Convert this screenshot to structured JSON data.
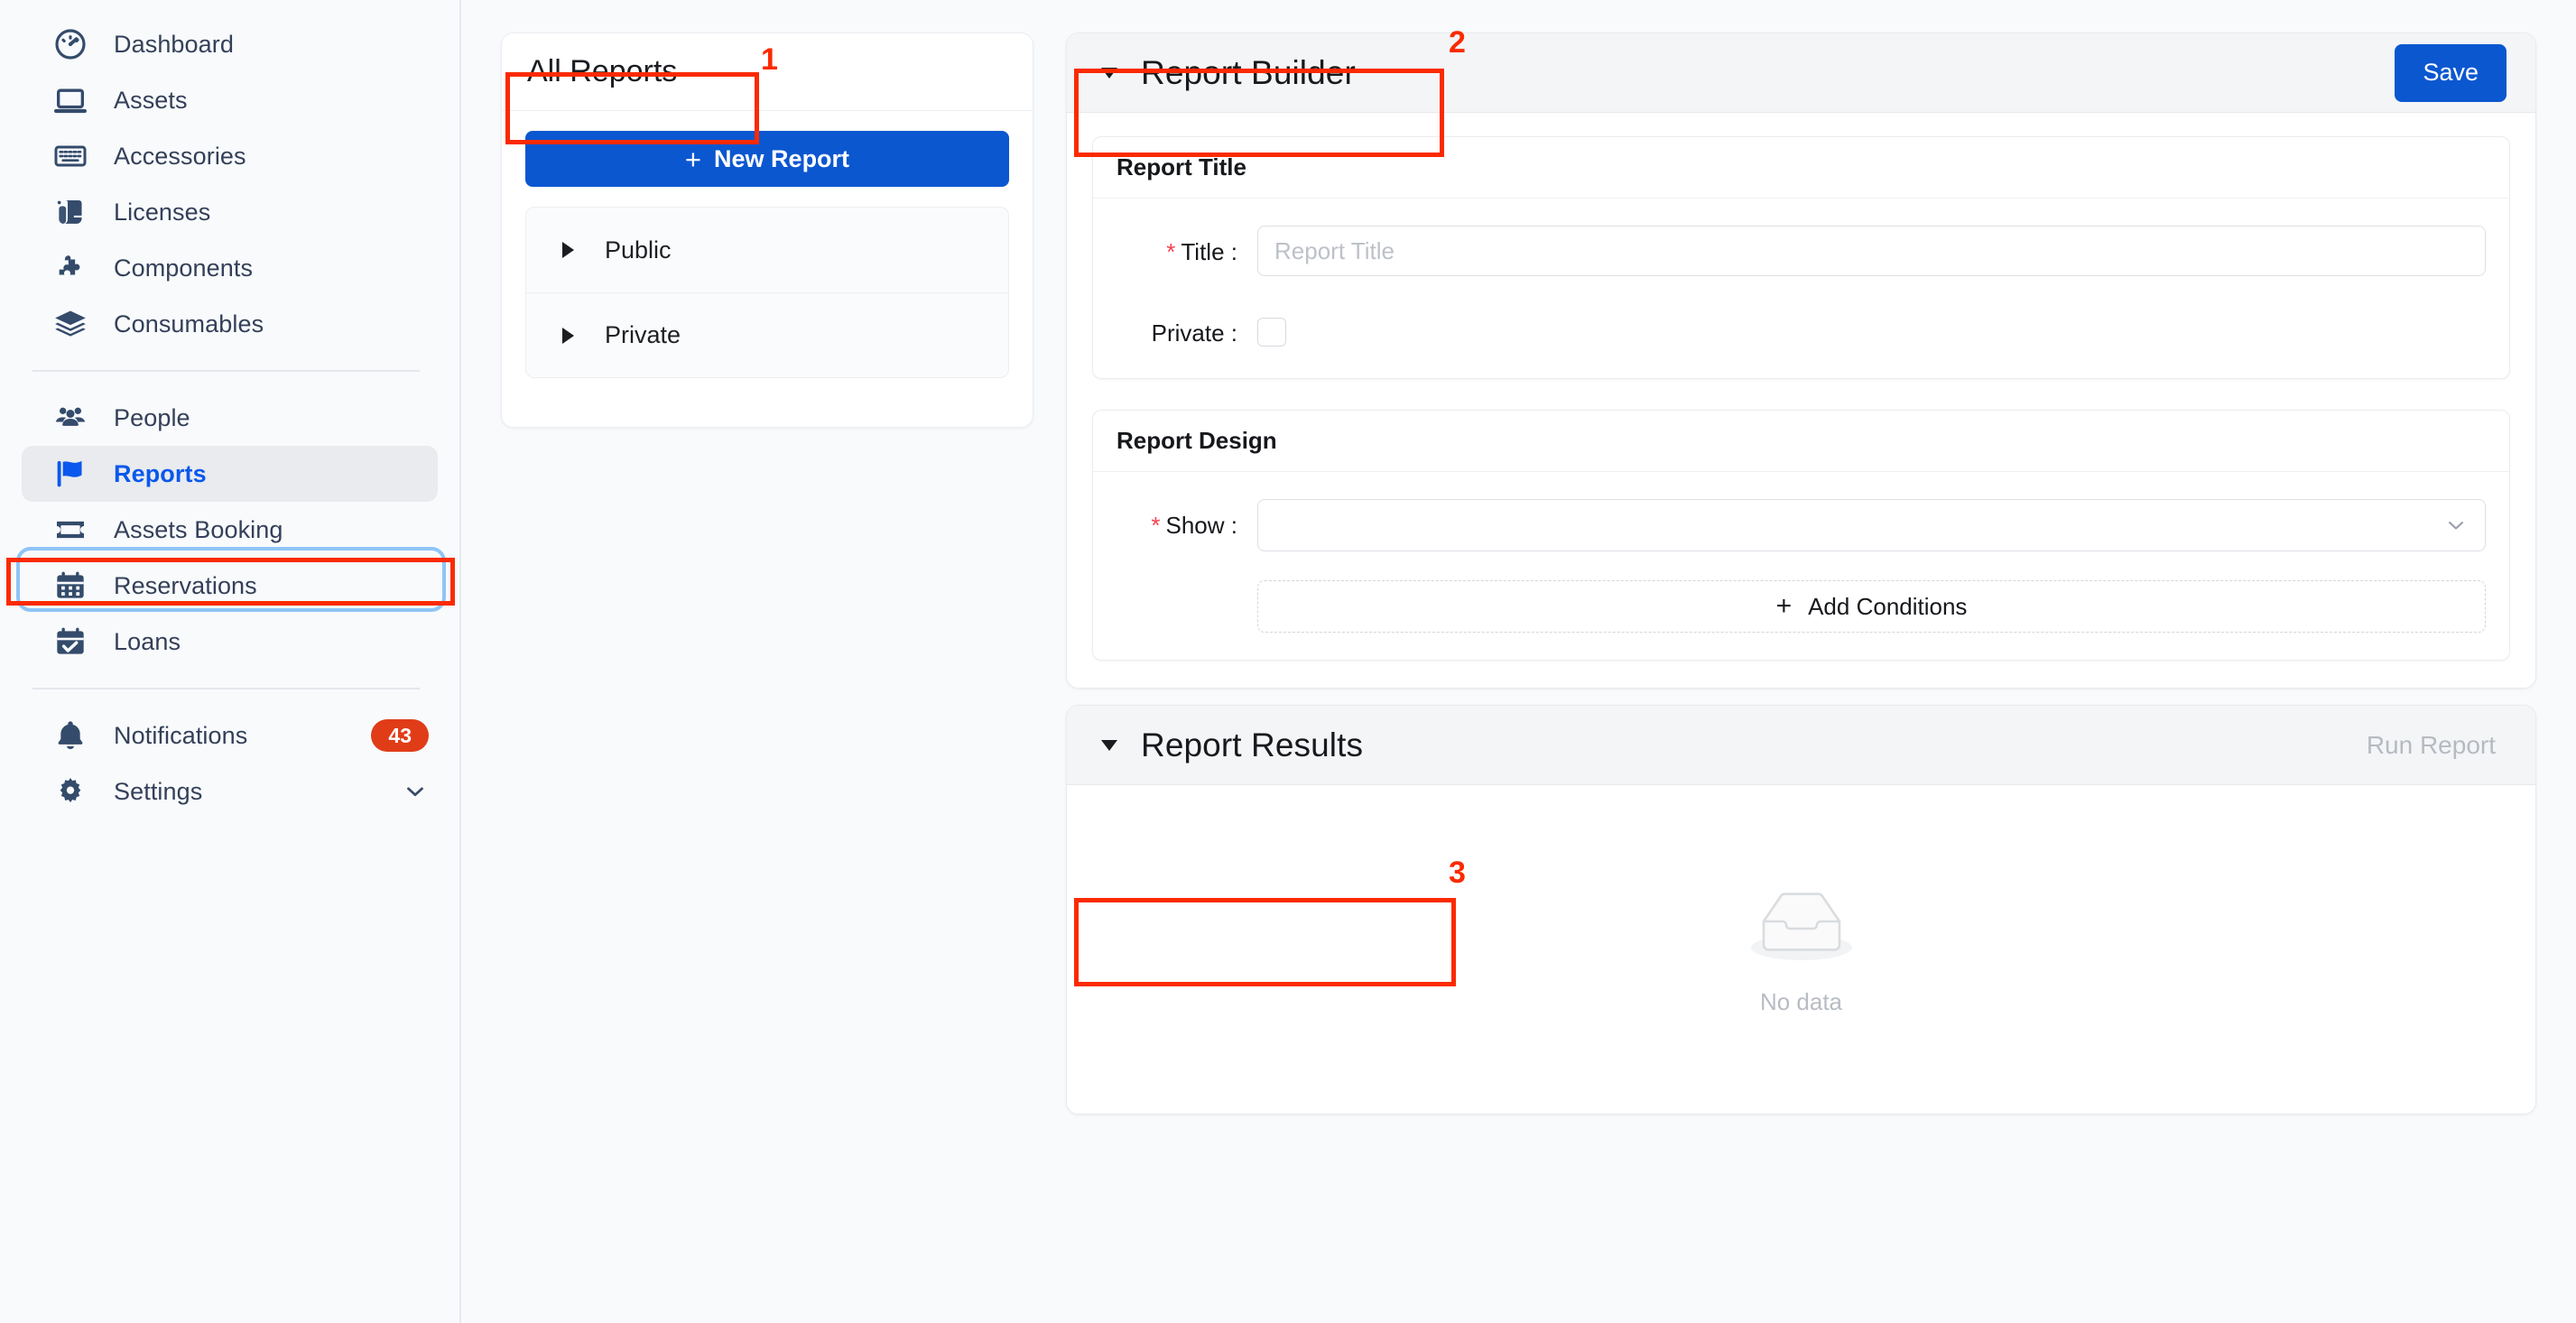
{
  "sidebar": {
    "items": [
      {
        "label": "Dashboard",
        "icon": "gauge-icon",
        "active": false
      },
      {
        "label": "Assets",
        "icon": "laptop-icon",
        "active": false
      },
      {
        "label": "Accessories",
        "icon": "keyboard-icon",
        "active": false
      },
      {
        "label": "Licenses",
        "icon": "scroll-icon",
        "active": false
      },
      {
        "label": "Components",
        "icon": "puzzle-icon",
        "active": false
      },
      {
        "label": "Consumables",
        "icon": "layers-icon",
        "active": false
      },
      {
        "label": "People",
        "icon": "people-icon",
        "active": false
      },
      {
        "label": "Reports",
        "icon": "flag-icon",
        "active": true
      },
      {
        "label": "Assets Booking",
        "icon": "ticket-icon",
        "active": false
      },
      {
        "label": "Reservations",
        "icon": "calendar-icon",
        "active": false
      },
      {
        "label": "Loans",
        "icon": "calendar-check-icon",
        "active": false
      },
      {
        "label": "Notifications",
        "icon": "bell-icon",
        "badge": "43",
        "active": false
      },
      {
        "label": "Settings",
        "icon": "gear-icon",
        "trailing": "chevron-down-icon",
        "active": false
      }
    ]
  },
  "reports_panel": {
    "title": "All Reports",
    "new_report_label": "New Report",
    "tree": [
      {
        "label": "Public"
      },
      {
        "label": "Private"
      }
    ]
  },
  "builder": {
    "title": "Report Builder",
    "save_label": "Save",
    "report_title_card": {
      "heading": "Report Title",
      "title_label": "Title :",
      "title_value": "",
      "title_placeholder": "Report Title",
      "private_label": "Private :",
      "private_checked": false
    },
    "report_design_card": {
      "heading": "Report Design",
      "show_label": "Show :",
      "show_value": "",
      "add_conditions_label": "Add Conditions"
    }
  },
  "results": {
    "title": "Report Results",
    "run_label": "Run Report",
    "empty_text": "No data"
  },
  "annotations": [
    {
      "number": "1",
      "target": "all-reports-title"
    },
    {
      "number": "2",
      "target": "report-builder-title"
    },
    {
      "number": "3",
      "target": "report-results-title"
    }
  ],
  "colors": {
    "accent_blue": "#0b57d0",
    "active_text": "#0a58ec",
    "badge_red": "#e03c18",
    "annotation_red": "#fb2a00",
    "sidebar_bg": "#f8fafc"
  }
}
